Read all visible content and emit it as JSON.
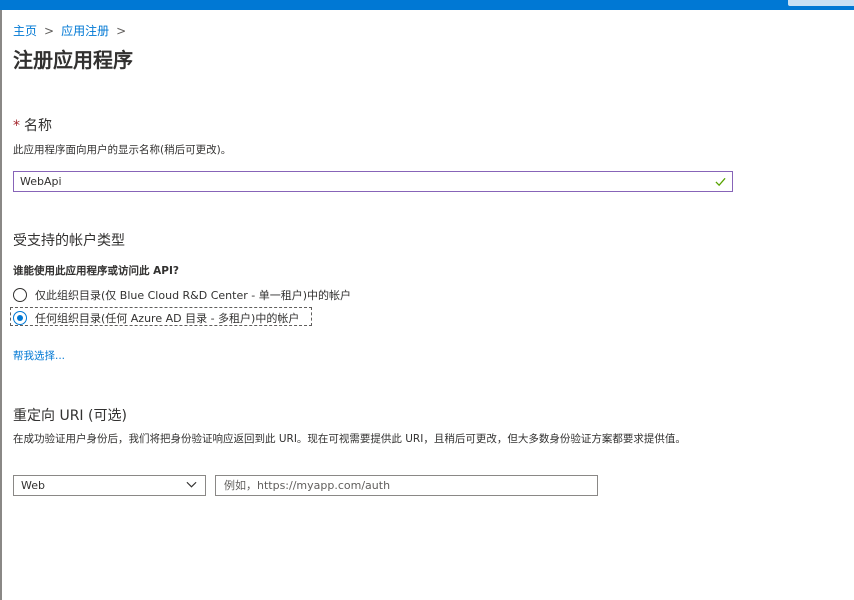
{
  "breadcrumb": {
    "items": [
      "主页",
      "应用注册"
    ],
    "separator": ">"
  },
  "page": {
    "title": "注册应用程序"
  },
  "name_section": {
    "required_marker": "*",
    "label": "名称",
    "help": "此应用程序面向用户的显示名称(稍后可更改)。",
    "value": "WebApi",
    "valid_icon": "check-icon"
  },
  "account_types": {
    "heading": "受支持的帐户类型",
    "question": "谁能使用此应用程序或访问此 API?",
    "options": [
      {
        "label": "仅此组织目录(仅 Blue Cloud R&D Center - 单一租户)中的帐户",
        "selected": false
      },
      {
        "label": "任何组织目录(任何 Azure AD 目录 - 多租户)中的帐户",
        "selected": true
      }
    ],
    "help_link": "帮我选择..."
  },
  "redirect": {
    "heading": "重定向 URI (可选)",
    "help": "在成功验证用户身份后，我们将把身份验证响应返回到此 URI。现在可视需要提供此 URI，且稍后可更改，但大多数身份验证方案都要求提供值。",
    "platform_value": "Web",
    "uri_placeholder": "例如，https://myapp.com/auth"
  },
  "colors": {
    "accent": "#0078d4",
    "input_focus_border": "#8764b8",
    "valid_check": "#57a300",
    "required": "#a4262c"
  }
}
